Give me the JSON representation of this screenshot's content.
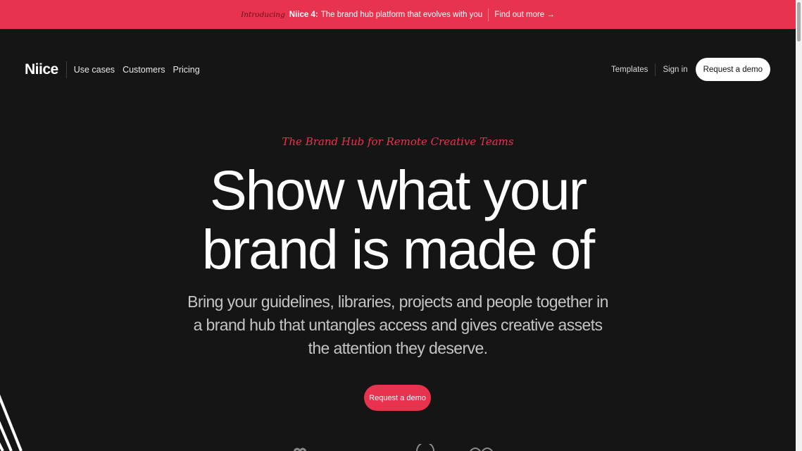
{
  "banner": {
    "intro": "Introducing",
    "brand": "Niice 4:",
    "text": "The brand hub platform that evolves with you",
    "link": "Find out more →"
  },
  "nav": {
    "logo": "Niice",
    "links": [
      "Use cases",
      "Customers",
      "Pricing"
    ],
    "templates": "Templates",
    "sign_in": "Sign in",
    "demo_button": "Request a demo"
  },
  "hero": {
    "tagline": "The Brand Hub for Remote Creative Teams",
    "headline_line1": "Show what your",
    "headline_line2": "brand is made of",
    "subtext": "Bring your guidelines, libraries, projects and people together in a brand hub that untangles access and gives creative assets the attention they deserve.",
    "cta": "Request a demo"
  },
  "colors": {
    "accent": "#e8334f",
    "background": "#151515",
    "text": "#ffffff"
  }
}
